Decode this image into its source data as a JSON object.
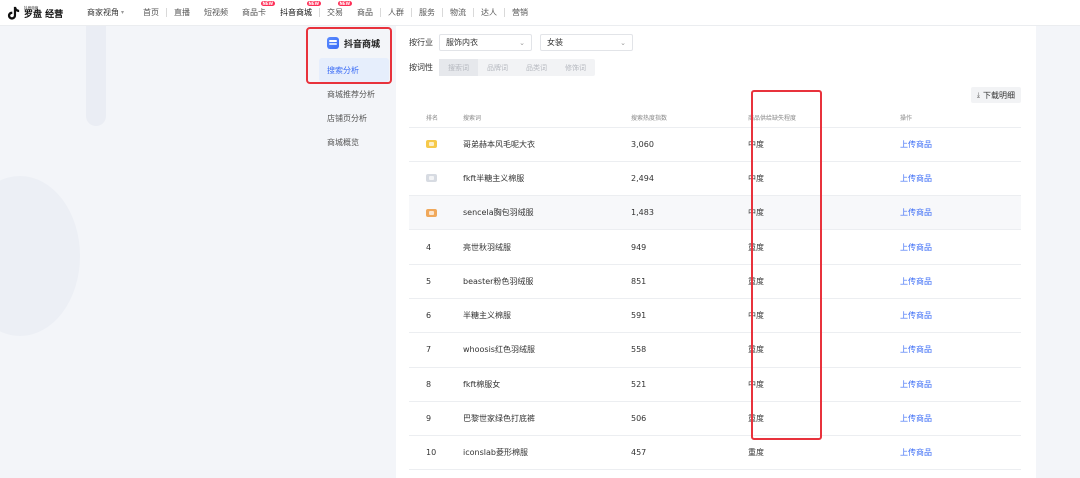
{
  "app": {
    "logo_small": "抖音电商",
    "logo_big": "罗盘 经营"
  },
  "nav": {
    "perspective": "商家视角",
    "items": [
      {
        "label": "首页"
      },
      {
        "label": "直播"
      },
      {
        "label": "短视频"
      },
      {
        "label": "商品卡",
        "badge": "NEW"
      },
      {
        "label": "抖音商城",
        "badge": "NEW"
      },
      {
        "label": "交易",
        "badge": "NEW"
      },
      {
        "label": "商品"
      },
      {
        "label": "人群"
      },
      {
        "label": "服务"
      },
      {
        "label": "物流"
      },
      {
        "label": "达人"
      },
      {
        "label": "营销"
      }
    ]
  },
  "sidebar": {
    "title": "抖音商城",
    "items": [
      {
        "label": "搜索分析",
        "active": true
      },
      {
        "label": "商城推荐分析"
      },
      {
        "label": "店铺页分析"
      },
      {
        "label": "商城概览"
      }
    ]
  },
  "filters": {
    "industry_label": "按行业",
    "industry_value": "服饰内衣",
    "category_value": "女装",
    "wordtype_label": "按词性",
    "wordtypes": [
      "搜索词",
      "品牌词",
      "品类词",
      "修饰词"
    ]
  },
  "download_label": "下载明细",
  "table": {
    "headers": [
      "排名",
      "搜索词",
      "搜索热度指数",
      "商品供给缺失程度",
      "操作"
    ],
    "rows": [
      {
        "rank": "1",
        "keyword": "哥弟赫本风毛呢大衣",
        "index": "3,060",
        "level": "中度",
        "action": "上传商品"
      },
      {
        "rank": "2",
        "keyword": "fkft半糖主义棉服",
        "index": "2,494",
        "level": "中度",
        "action": "上传商品"
      },
      {
        "rank": "3",
        "keyword": "sencela胸包羽绒服",
        "index": "1,483",
        "level": "中度",
        "action": "上传商品"
      },
      {
        "rank": "4",
        "keyword": "亮世秋羽绒服",
        "index": "949",
        "level": "重度",
        "action": "上传商品"
      },
      {
        "rank": "5",
        "keyword": "beaster粉色羽绒服",
        "index": "851",
        "level": "重度",
        "action": "上传商品"
      },
      {
        "rank": "6",
        "keyword": "半糖主义棉服",
        "index": "591",
        "level": "中度",
        "action": "上传商品"
      },
      {
        "rank": "7",
        "keyword": "whoosis红色羽绒服",
        "index": "558",
        "level": "重度",
        "action": "上传商品"
      },
      {
        "rank": "8",
        "keyword": "fkft棉服女",
        "index": "521",
        "level": "中度",
        "action": "上传商品"
      },
      {
        "rank": "9",
        "keyword": "巴黎世家绿色打底裤",
        "index": "506",
        "level": "重度",
        "action": "上传商品"
      },
      {
        "rank": "10",
        "keyword": "iconslab菱形棉服",
        "index": "457",
        "level": "重度",
        "action": "上传商品"
      }
    ]
  },
  "colors": {
    "accent": "#3b6cf6",
    "highlight_box": "#e8323c",
    "badge": "#fe2c55"
  }
}
